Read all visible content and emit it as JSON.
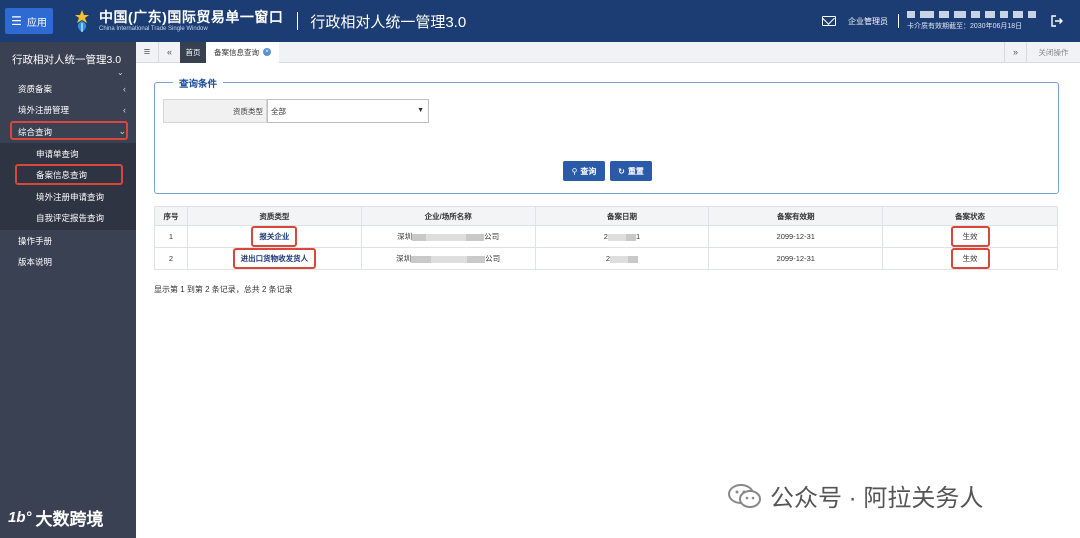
{
  "header": {
    "app_label": "应用",
    "brand_cn": "中国(广东)国际贸易单一窗口",
    "brand_en": "China International Trade Single Window",
    "system_title": "行政相对人统一管理3.0",
    "admin_label": "企业管理员",
    "expiry_text": "卡介质有效期截至：2030年06月18日"
  },
  "sidebar": {
    "title": "行政相对人统一管理3.0",
    "items": [
      {
        "label": "资质备案"
      },
      {
        "label": "境外注册管理"
      },
      {
        "label": "综合查询"
      }
    ],
    "sub_items": [
      {
        "label": "申请单查询"
      },
      {
        "label": "备案信息查询"
      },
      {
        "label": "境外注册申请查询"
      },
      {
        "label": "自我评定报告查询"
      }
    ],
    "bottom_items": [
      {
        "label": "操作手册"
      },
      {
        "label": "版本说明"
      }
    ]
  },
  "tabs": {
    "home": "首页",
    "active": "备案信息查询",
    "close_ops": "关闭操作"
  },
  "query": {
    "legend": "查询条件",
    "field_label": "资质类型",
    "field_value": "全部",
    "search_button": "查询",
    "reset_button": "重置"
  },
  "table": {
    "headers": [
      "序号",
      "资质类型",
      "企业/场所名称",
      "备案日期",
      "备案有效期",
      "备案状态"
    ],
    "rows": [
      {
        "index": "1",
        "type": "报关企业",
        "name_prefix": "深圳",
        "name_suffix": "公司",
        "date_prefix": "2",
        "date_suffix": "1",
        "valid_until": "2099-12-31",
        "status": "生效"
      },
      {
        "index": "2",
        "type": "进出口货物收发货人",
        "name_prefix": "深圳",
        "name_suffix": "公司",
        "date_prefix": "2",
        "date_suffix": "",
        "valid_until": "2099-12-31",
        "status": "生效"
      }
    ],
    "summary": "显示第 1 到第 2 条记录，总共 2 条记录"
  },
  "watermarks": {
    "left_text": "大数跨境",
    "left_mark": "1b°",
    "right_text": "公众号 · 阿拉关务人"
  },
  "colors": {
    "header_bg": "#1c3d73",
    "sidebar_bg": "#3a4152",
    "primary_button": "#2a5aa8",
    "highlight_red": "#d9473b"
  }
}
